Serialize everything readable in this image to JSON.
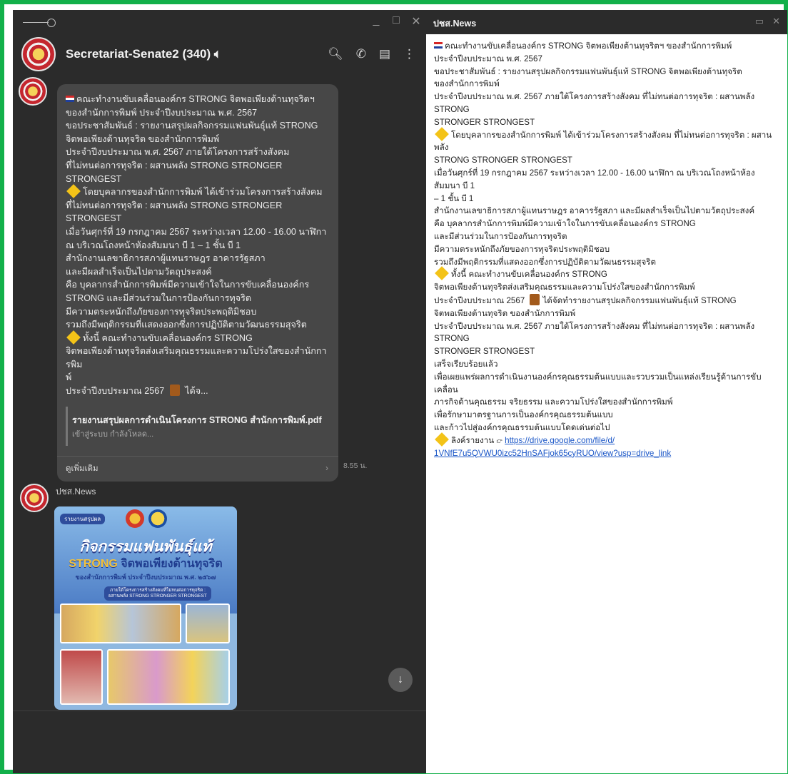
{
  "left_window": {
    "chat_title": "Secretariat-Senate2 (340)",
    "header_icons": [
      "mute-icon",
      "search-icon",
      "phone-icon",
      "notes-icon",
      "more-icon"
    ],
    "message1": {
      "lines": [
        "คณะทำงานขับเคลื่อนองค์กร STRONG จิตพอเพียงต้านทุจริตฯ",
        "ของสำนักการพิมพ์ ประจำปีงบประมาณ พ.ศ. 2567",
        "ขอประชาสัมพันธ์ : รายงานสรุปผลกิจกรรมแฟนพันธุ์แท้ STRONG",
        "จิตพอเพียงต้านทุจริต ของสำนักการพิมพ์",
        "ประจำปีงบประมาณ พ.ศ. 2567 ภายใต้โครงการสร้างสังคม",
        "ที่ไม่ทนต่อการทุจริต : ผสานพลัง STRONG STRONGER",
        "STRONGEST",
        "โดยบุคลากรของสำนักการพิมพ์ ได้เข้าร่วมโครงการสร้างสังคม",
        "ที่ไม่ทนต่อการทุจริต : ผสานพลัง STRONG STRONGER",
        "STRONGEST",
        "เมื่อวันศุกร์ที่ 19 กรกฎาคม 2567 ระหว่างเวลา 12.00 - 16.00 นาฬิกา",
        "ณ บริเวณโถงหน้าห้องสัมมนา บี 1 – 1 ชั้น บี 1",
        "สำนักงานเลขาธิการสภาผู้แทนราษฎร อาคารรัฐสภา",
        "และมีผลสำเร็จเป็นไปตามวัตถุประสงค์",
        "คือ บุคลากรสำนักการพิมพ์มีความเข้าใจในการขับเคลื่อนองค์กร",
        "STRONG และมีส่วนร่วมในการป้องกันการทุจริต",
        "มีความตระหนักถึงภัยของการทุจริตประพฤติมิชอบ",
        "รวมถึงมีพฤติกรรมที่แสดงออกซึ่งการปฏิบัติตามวัฒนธรรมสุจริต",
        "ทั้งนี้ คณะทำงานขับเคลื่อนองค์กร STRONG",
        "จิตพอเพียงต้านทุจริตส่งเสริมคุณธรรมและความโปร่งใสของสำนักการพิม",
        "พ์",
        "ประจำปีงบประมาณ 2567",
        "ได้จ..."
      ],
      "file_name": "รายงานสรุปผลการดำเนินโครงการ STRONG สำนักการพิมพ์.pdf",
      "file_status": "เข้าสู่ระบบ กำลังโหลด...",
      "see_more": "ดูเพิ่มเติม",
      "time": "8.55 น."
    },
    "message2": {
      "sender": "ปชส.News",
      "poster_tag": "รายงานสรุปผล",
      "poster_title": "กิจกรรมแฟนพันธุ์แท้",
      "poster_subtitle_a": "STRONG",
      "poster_subtitle_b": "จิตพอเพียงต้านทุจริต",
      "poster_line3": "ของสำนักการพิมพ์ ประจำปีงบประมาณ พ.ศ. ๒๕๖๗",
      "poster_box": "ภายใต้โครงการสร้างสังคมที่ไม่ทนต่อการทุจริต : ผสานพลัง STRONG STRONGER STRONGEST"
    }
  },
  "right_window": {
    "title": "ปชส.News",
    "lines": [
      "คณะทำงานขับเคลื่อนองค์กร STRONG จิตพอเพียงต้านทุจริตฯ ของสำนักการพิมพ์",
      "ประจำปีงบประมาณ พ.ศ. 2567",
      "ขอประชาสัมพันธ์ : รายงานสรุปผลกิจกรรมแฟนพันธุ์แท้ STRONG จิตพอเพียงต้านทุจริต",
      "ของสำนักการพิมพ์",
      "ประจำปีงบประมาณ พ.ศ. 2567 ภายใต้โครงการสร้างสังคม ที่ไม่ทนต่อการทุจริต : ผสานพลัง STRONG",
      "STRONGER STRONGEST",
      "โดยบุคลากรของสำนักการพิมพ์ ได้เข้าร่วมโครงการสร้างสังคม ที่ไม่ทนต่อการทุจริต : ผสานพลัง",
      "STRONG STRONGER STRONGEST",
      "เมื่อวันศุกร์ที่ 19 กรกฎาคม 2567 ระหว่างเวลา 12.00 - 16.00 นาฬิกา ณ บริเวณโถงหน้าห้องสัมมนา บี 1",
      "– 1 ชั้น บี 1",
      "สำนักงานเลขาธิการสภาผู้แทนราษฎร อาคารรัฐสภา และมีผลสำเร็จเป็นไปตามวัตถุประสงค์",
      "คือ บุคลากรสำนักการพิมพ์มีความเข้าใจในการขับเคลื่อนองค์กร STRONG",
      "และมีส่วนร่วมในการป้องกันการทุจริต",
      "มีความตระหนักถึงภัยของการทุจริตประพฤติมิชอบ",
      "รวมถึงมีพฤติกรรมที่แสดงออกซึ่งการปฏิบัติตามวัฒนธรรมสุจริต",
      "ทั้งนี้ คณะทำงานขับเคลื่อนองค์กร STRONG",
      "จิตพอเพียงต้านทุจริตส่งเสริมคุณธรรมและความโปร่งใสของสำนักการพิมพ์",
      "ประจำปีงบประมาณ 2567",
      "ได้จัดทำรายงานสรุปผลกิจกรรมแฟนพันธุ์แท้ STRONG",
      "จิตพอเพียงต้านทุจริต ของสำนักการพิมพ์",
      "ประจำปีงบประมาณ พ.ศ. 2567 ภายใต้โครงการสร้างสังคม ที่ไม่ทนต่อการทุจริต : ผสานพลัง STRONG",
      "STRONGER STRONGEST",
      "เสร็จเรียบร้อยแล้ว",
      "เพื่อเผยแพร่ผลการดำเนินงานองค์กรคุณธรรมต้นแบบและรวบรวมเป็นแหล่งเรียนรู้ด้านการขับเคลื่อน",
      "ภารกิจด้านคุณธรรม จริยธรรม และความโปร่งใสของสำนักการพิมพ์",
      "เพื่อรักษามาตรฐานการเป็นองค์กรคุณธรรมต้นแบบ",
      "และก้าวไปสู่องค์กรคุณธรรมต้นแบบโดดเด่นต่อไป",
      "ลิงค์รายงาน"
    ],
    "link_line1": "https://drive.google.com/file/d/",
    "link_line2": "1VNfE7u5QVWU0izc52HnSAFjok65cyRUO/view?usp=drive_link"
  },
  "colors": {
    "frame": "#12b04a",
    "chat_bg": "#2b2b2b",
    "bubble": "#474747",
    "link": "#1a56c7"
  }
}
